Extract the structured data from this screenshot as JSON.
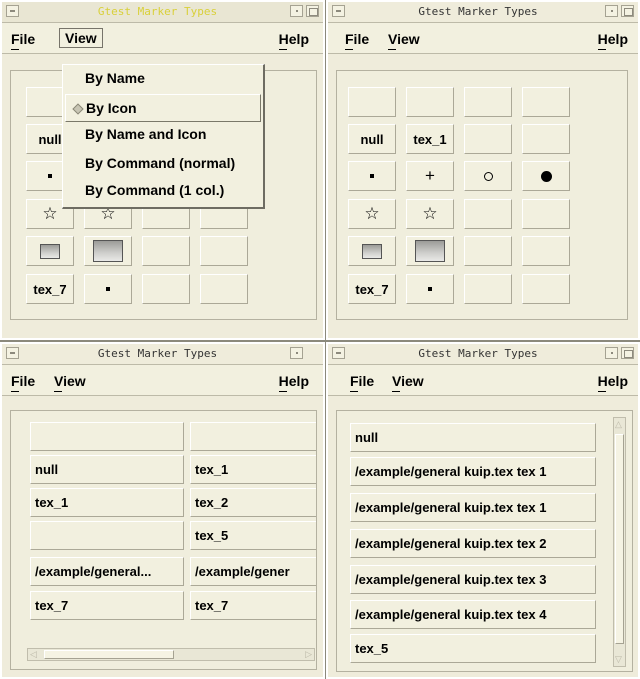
{
  "windows": [
    {
      "title": "Gtest Marker Types",
      "menu": {
        "file": "File",
        "view": "View",
        "help": "Help"
      }
    },
    {
      "title": "Gtest Marker Types",
      "menu": {
        "file": "File",
        "view": "View",
        "help": "Help"
      }
    },
    {
      "title": "Gtest Marker Types",
      "menu": {
        "file": "File",
        "view": "View",
        "help": "Help"
      }
    },
    {
      "title": "Gtest Marker Types",
      "menu": {
        "file": "File",
        "view": "View",
        "help": "Help"
      }
    }
  ],
  "view_menu": {
    "items": [
      "By Name",
      "By Icon",
      "By Name and Icon",
      "By Command (normal)",
      "By Command (1 col.)"
    ],
    "selected": "By Icon"
  },
  "icon_grid": {
    "null": "null",
    "tex_1": "tex_1",
    "tex_7": "tex_7",
    "plus": "+",
    "star": "☆"
  },
  "name_icon_grid": {
    "col1": [
      "",
      "null",
      "tex_1",
      "",
      "/example/general...",
      "tex_7"
    ],
    "col2": [
      "",
      "tex_1",
      "tex_2",
      "tex_5",
      "/example/gener",
      "tex_7"
    ]
  },
  "command_list": [
    "null",
    "/example/general kuip.tex tex 1",
    "/example/general kuip.tex tex 1",
    "/example/general kuip.tex tex 2",
    "/example/general kuip.tex tex 3",
    "/example/general kuip.tex tex 4",
    "tex_5"
  ],
  "colors": {
    "background": "#efecdb",
    "active_title": "#d9d03a"
  }
}
